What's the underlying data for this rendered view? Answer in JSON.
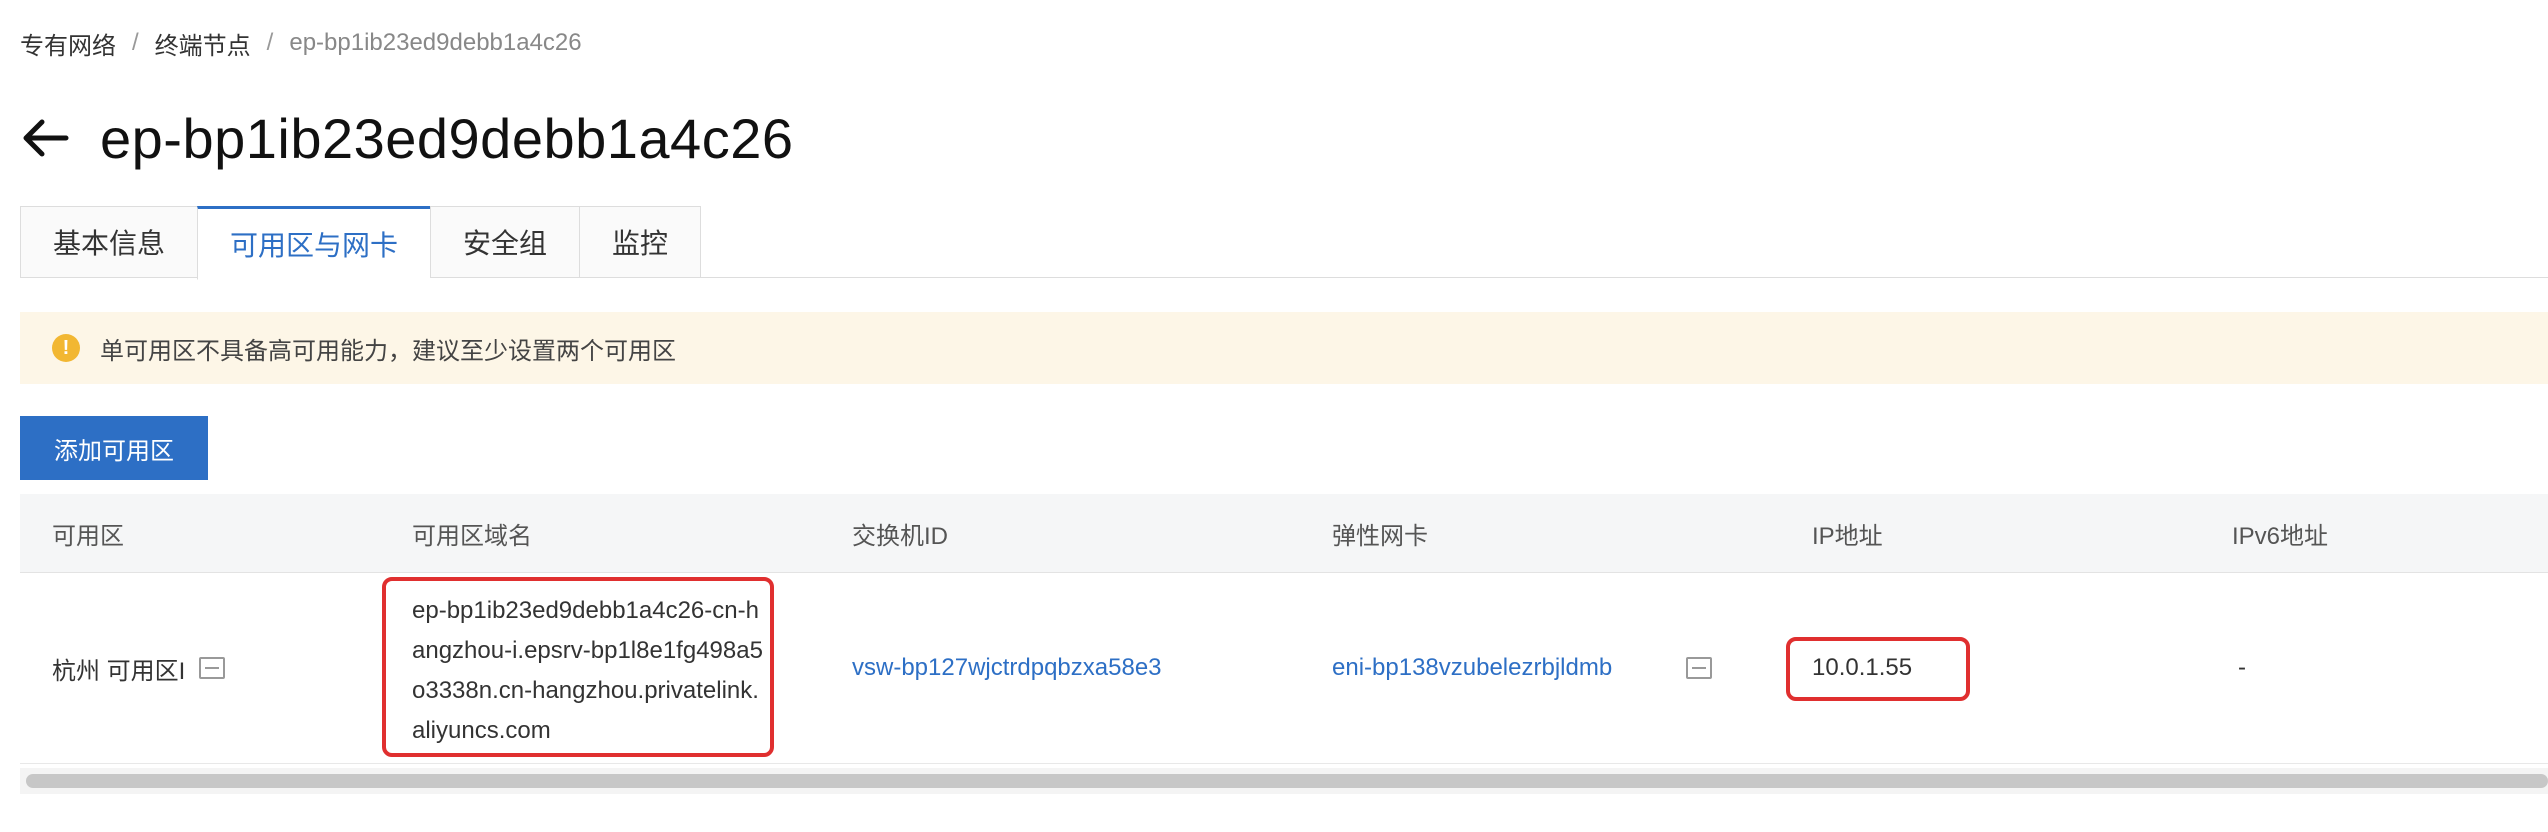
{
  "breadcrumb": {
    "items": [
      "专有网络",
      "终端节点",
      "ep-bp1ib23ed9debb1a4c26"
    ],
    "separator": "/"
  },
  "header": {
    "title": "ep-bp1ib23ed9debb1a4c26"
  },
  "tabs": [
    {
      "label": "基本信息"
    },
    {
      "label": "可用区与网卡"
    },
    {
      "label": "安全组"
    },
    {
      "label": "监控"
    }
  ],
  "alert": {
    "icon": "!",
    "text": "单可用区不具备高可用能力，建议至少设置两个可用区"
  },
  "toolbar": {
    "add_label": "添加可用区"
  },
  "table": {
    "columns": [
      "可用区",
      "可用区域名",
      "交换机ID",
      "弹性网卡",
      "IP地址",
      "IPv6地址"
    ],
    "rows": [
      {
        "zone": "杭州 可用区I",
        "domain": "ep-bp1ib23ed9debb1a4c26-cn-hangzhou-i.epsrv-bp1l8e1fg498a5o3338n.cn-hangzhou.privatelink.aliyuncs.com",
        "vswitch": "vsw-bp127wjctrdpqbzxa58e3",
        "eni": "eni-bp138vzubelezrbjldmb",
        "ip": "10.0.1.55",
        "ipv6": "-"
      }
    ]
  },
  "colors": {
    "primary": "#2d6fc5",
    "highlight": "#e02f2f",
    "alert_bg": "#fdf6e7",
    "alert_icon": "#f2b732"
  }
}
